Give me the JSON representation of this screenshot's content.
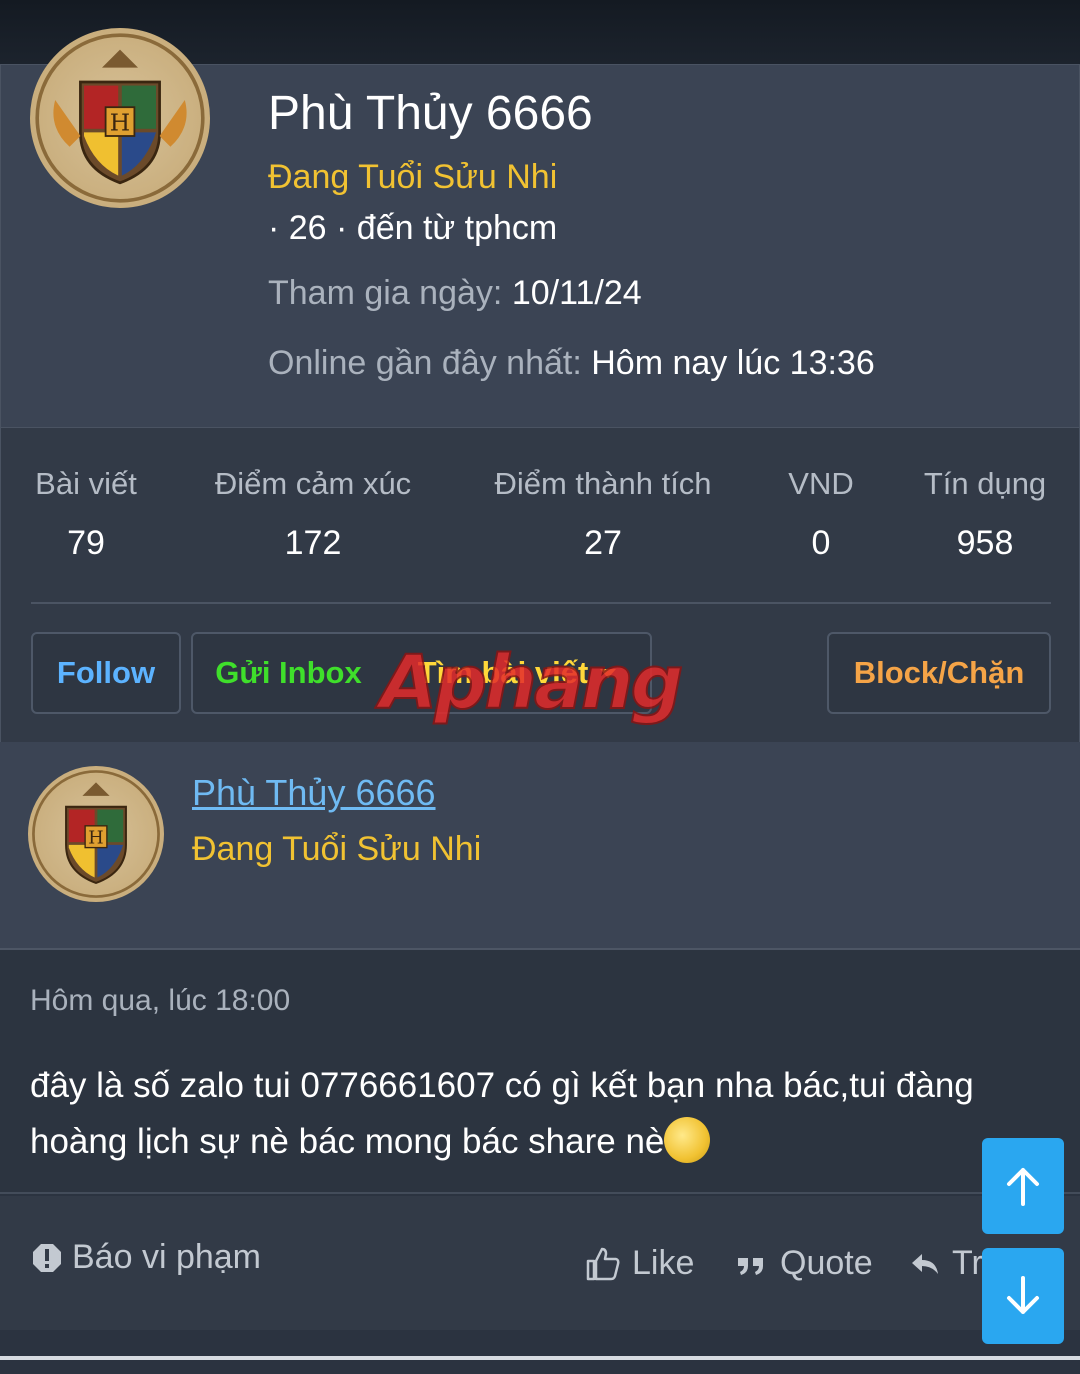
{
  "profile": {
    "name": "Phù Thủy 6666",
    "title": "Đang Tuổi Sửu Nhi",
    "extra": "· 26 · đến từ tphcm",
    "joined_label": "Tham gia ngày:",
    "joined_value": "10/11/24",
    "online_label": "Online gần đây nhất:",
    "online_value": "Hôm nay lúc 13:36"
  },
  "stats": [
    {
      "label": "Bài viết",
      "value": "79"
    },
    {
      "label": "Điểm cảm xúc",
      "value": "172"
    },
    {
      "label": "Điểm thành tích",
      "value": "27"
    },
    {
      "label": "VND",
      "value": "0"
    },
    {
      "label": "Tín dụng",
      "value": "958"
    }
  ],
  "buttons": {
    "follow": "Follow",
    "inbox": "Gửi Inbox",
    "find_posts": "Tìm bài viết",
    "block": "Block/Chặn"
  },
  "watermark": "Aphang",
  "post": {
    "author": "Phù Thủy 6666",
    "author_title": "Đang Tuổi Sửu Nhi",
    "time": "Hôm qua, lúc 18:00",
    "text": "đây là số zalo tui 0776661607 có gì kết bạn nha bác,tui đàng hoàng lịch sự nè bác mong bác share nè"
  },
  "actions": {
    "report": "Báo vi phạm",
    "like": "Like",
    "quote": "Quote",
    "reply": "Tr"
  },
  "colors": {
    "accent_blue": "#2aa7f0",
    "user_title": "#f1c232",
    "follow": "#5cb3ff",
    "inbox": "#3fdf2b",
    "find": "#ffd83a",
    "block": "#f5a447"
  }
}
